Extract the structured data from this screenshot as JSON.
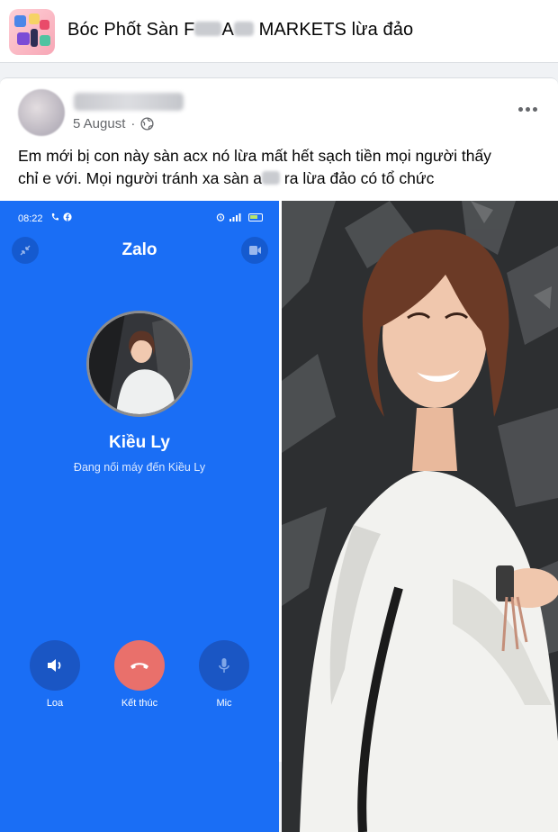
{
  "group": {
    "title_part1": "Bóc Phốt Sàn F",
    "title_part2": "A",
    "title_part3": " MARKETS lừa đảo"
  },
  "post": {
    "date": "5 August",
    "text_line1": "Em mới bị con này sàn acx nó lừa mất hết sạch tiền mọi người thấy",
    "text_line2_a": "chỉ e với. Mọi người tránh xa sàn a",
    "text_line2_b": " ra lừa đảo có tổ chức"
  },
  "zalo_call": {
    "time": "08:22",
    "app_title": "Zalo",
    "contact_name": "Kiều Ly",
    "status": "Đang nối máy đến Kiều Ly",
    "speaker_label": "Loa",
    "end_label": "Kết thúc",
    "mic_label": "Mic"
  },
  "colors": {
    "zalo_blue": "#1a6ef5",
    "end_call_red": "#e9706b",
    "control_dark": "#1a56c4"
  },
  "icons": [
    "globe-icon",
    "more-icon",
    "minimize-icon",
    "video-icon",
    "speaker-icon",
    "end-call-icon",
    "mic-icon"
  ]
}
